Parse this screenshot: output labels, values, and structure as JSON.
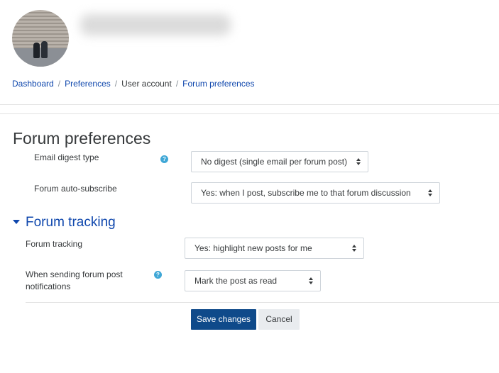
{
  "header": {
    "avatar_alt": "User picture"
  },
  "breadcrumb": [
    {
      "label": "Dashboard"
    },
    {
      "label": "Preferences"
    },
    {
      "label": "User account"
    },
    {
      "label": "Forum preferences"
    }
  ],
  "page": {
    "title": "Forum preferences"
  },
  "fields": {
    "email_digest": {
      "label": "Email digest type",
      "value": "No digest (single email per forum post)"
    },
    "auto_subscribe": {
      "label": "Forum auto-subscribe",
      "value": "Yes: when I post, subscribe me to that forum discussion"
    }
  },
  "tracking_section": {
    "title": "Forum tracking",
    "tracking": {
      "label": "Forum tracking",
      "value": "Yes: highlight new posts for me"
    },
    "notifications": {
      "label_line1": "When sending forum post",
      "label_line2": "notifications",
      "value": "Mark the post as read"
    }
  },
  "actions": {
    "save": "Save changes",
    "cancel": "Cancel"
  },
  "icons": {
    "help": "?"
  },
  "colors": {
    "link": "#0f47ad",
    "primary_button": "#0f4a8a",
    "help_icon": "#3fa7d6"
  }
}
